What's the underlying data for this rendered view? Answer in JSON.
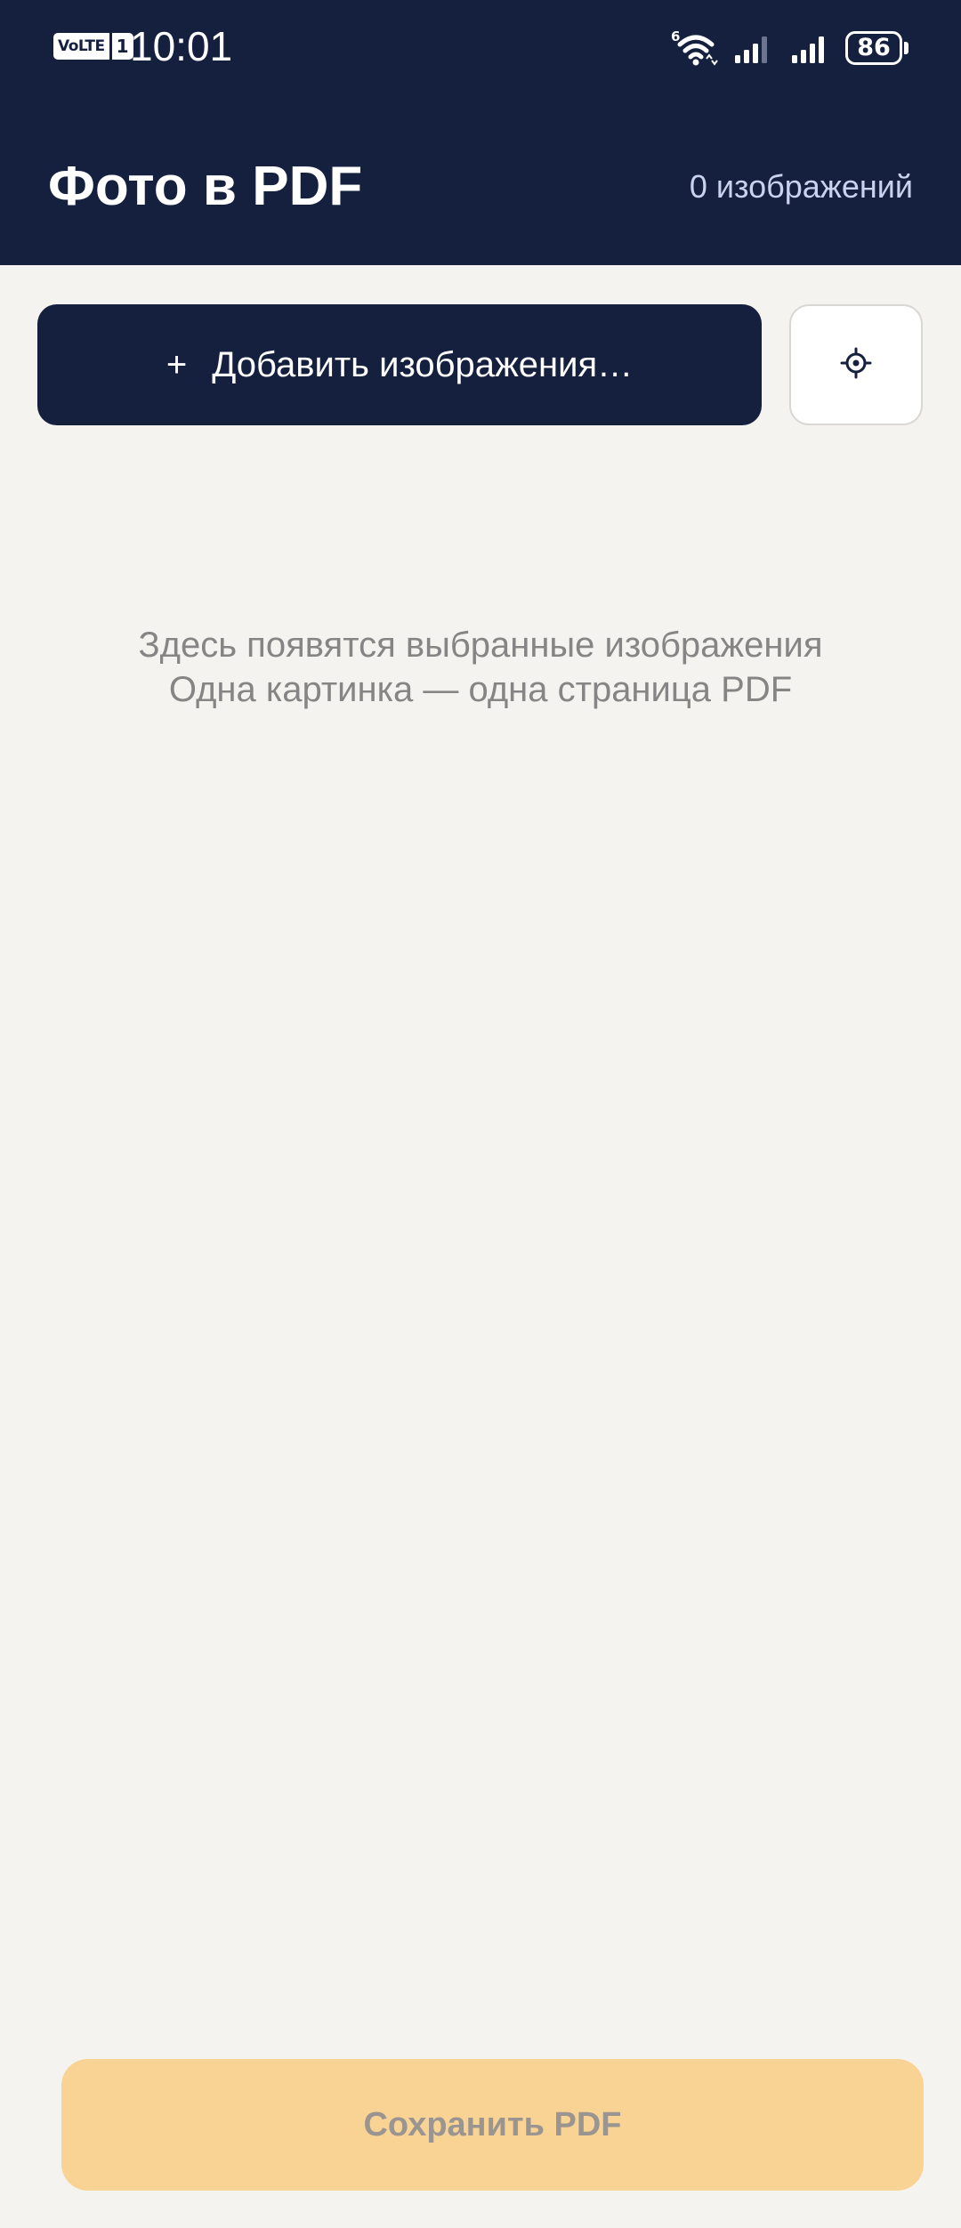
{
  "status_bar": {
    "volte_label": "VoLTE",
    "sim_label": "1",
    "time": "10:01",
    "wifi_badge": "6",
    "battery_percent": "86",
    "battery_level": 0.86
  },
  "header": {
    "title": "Фото в PDF",
    "image_count": "0 изображений",
    "background_color": "#14203d"
  },
  "toolbar": {
    "add_icon": "+",
    "add_label": "Добавить изображения…",
    "settings_icon": "settings-icon"
  },
  "empty_state": {
    "line1": "Здесь появятся выбранные изображения",
    "line2": "Одна картинка — одна страница PDF"
  },
  "footer": {
    "save_label": "Сохранить PDF",
    "save_color": "#f8d394"
  }
}
